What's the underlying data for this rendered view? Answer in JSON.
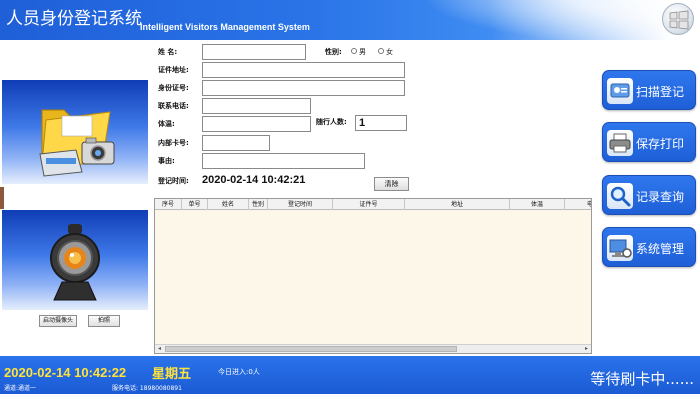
{
  "header": {
    "title_cn": "人员身份登记系统",
    "title_en": "Intelligent Visitors Management System",
    "logo_icon": "windows-logo-icon"
  },
  "left": {
    "folder_icon": "folder-camera-icon",
    "webcam_icon": "webcam-icon",
    "start_camera_label": "启动摄像头",
    "photo_label": "拍照"
  },
  "form": {
    "name_label": "姓    名:",
    "name_value": "",
    "gender_label": "性别:",
    "gender_male": "男",
    "gender_female": "女",
    "id_address_label": "证件地址:",
    "id_address_value": "",
    "id_number_label": "身份证号:",
    "id_number_value": "",
    "phone_label": "联系电话:",
    "phone_value": "",
    "temperature_label": "体温:",
    "temperature_value": "",
    "companions_label": "随行人数:",
    "companions_value": "1",
    "card_label": "内部卡号:",
    "card_value": "",
    "reason_label": "事由:",
    "reason_value": "",
    "reg_time_label": "登记时间:",
    "reg_time_value": "2020-02-14 10:42:21",
    "clear_label": "清除"
  },
  "table": {
    "columns": [
      "序号",
      "单号",
      "姓名",
      "性别",
      "登记时间",
      "证件号",
      "地址",
      "体温",
      "电"
    ],
    "rows": []
  },
  "actions": {
    "scan": "扫描登记",
    "print": "保存打印",
    "query": "记录查询",
    "manage": "系统管理"
  },
  "footer": {
    "datetime": "2020-02-14 10:42:22",
    "weekday": "星期五",
    "today_count": "今日进入:0人",
    "channel": "通道:通道一",
    "service_phone": "服务电话: 18980080891",
    "status": "等待刷卡中......",
    "accent_color": "#ffe23a"
  }
}
